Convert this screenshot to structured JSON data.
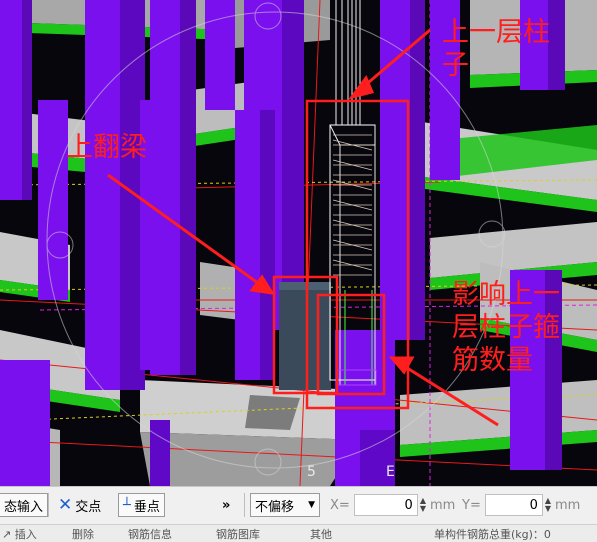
{
  "annotations": {
    "upper_column_line1": "上一层柱",
    "upper_column_line2": "子",
    "upturned_beam": "上翻梁",
    "affect_line1": "影响上一",
    "affect_line2": "层柱子箍",
    "affect_line3": "筋数量"
  },
  "viewport": {
    "axis_label_a": "5",
    "axis_label_b": "E"
  },
  "toolbar": {
    "dynamic_input_label": "态输入",
    "intersection_label": "交点",
    "perpendicular_label": "垂点",
    "more_glyph": "»",
    "offset_select_value": "不偏移",
    "x_label": "X=",
    "x_value": "0",
    "x_unit": "mm",
    "y_label": "Y=",
    "y_value": "0",
    "y_unit": "mm"
  },
  "statusbar": {
    "item1": "↗ 插入",
    "item2": "删除",
    "item3": "钢筋信息",
    "item4": "钢筋图库",
    "item5": "其他",
    "item6": "单构件钢筋总重(kg)：0"
  },
  "colors": {
    "annotation_red": "#ff1e1e",
    "column_purple": "#7a10ee",
    "beam_green": "#1fc41a",
    "slab_gray": "#b8b8b8"
  }
}
